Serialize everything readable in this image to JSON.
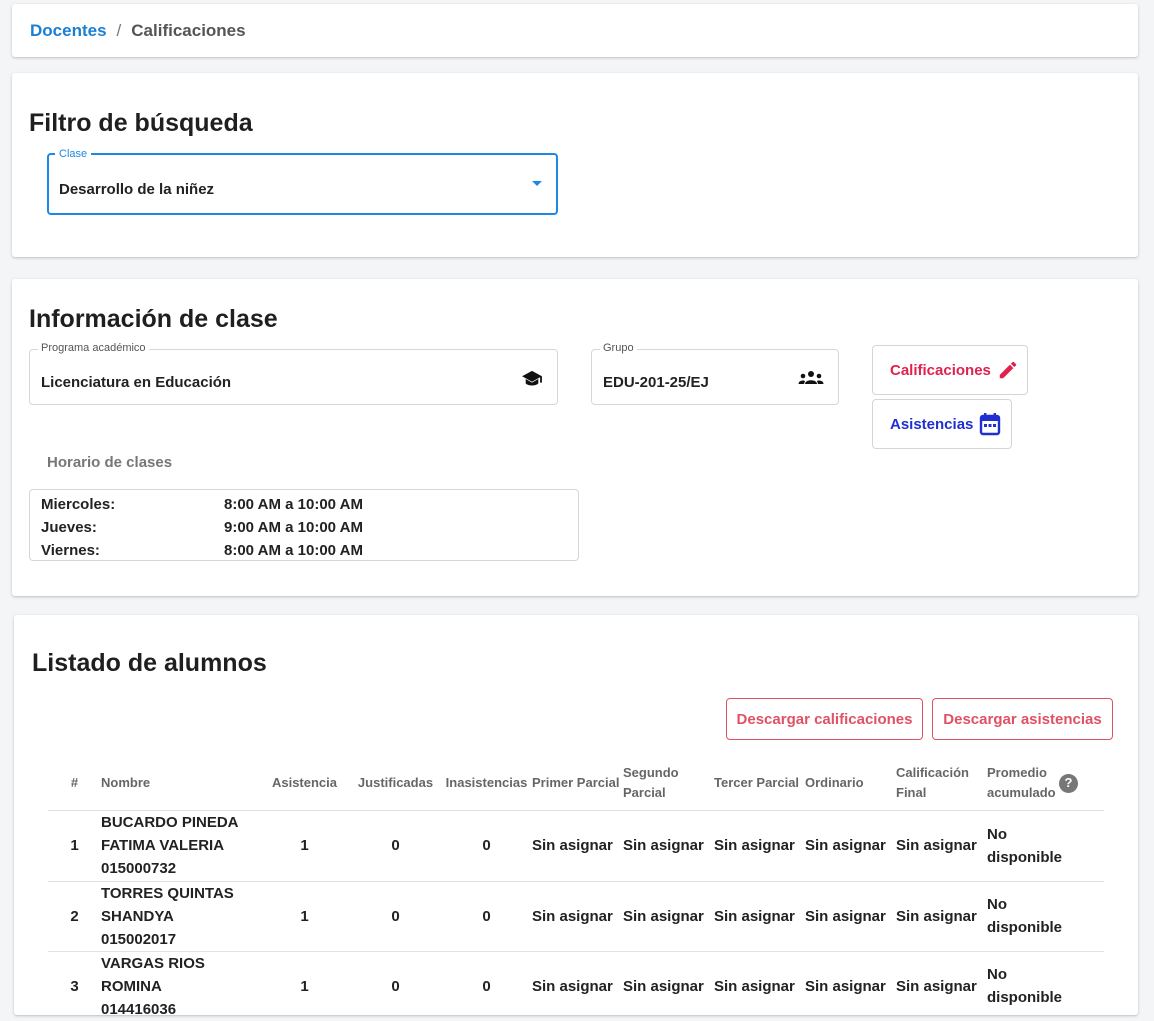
{
  "breadcrumb": {
    "parent": "Docentes",
    "separator": "/",
    "current": "Calificaciones"
  },
  "filter": {
    "title": "Filtro de búsqueda",
    "clase": {
      "label": "Clase",
      "value": "Desarrollo de la niñez"
    }
  },
  "class_info": {
    "title": "Información de clase",
    "programa": {
      "label": "Programa académico",
      "value": "Licenciatura en Educación"
    },
    "grupo": {
      "label": "Grupo",
      "value": "EDU-201-25/EJ"
    },
    "buttons": {
      "calificaciones": "Calificaciones",
      "asistencias": "Asistencias"
    },
    "schedule_label": "Horario de clases",
    "schedule": [
      {
        "day": "Miercoles:",
        "time": "8:00 AM a 10:00 AM"
      },
      {
        "day": "Jueves:",
        "time": "9:00 AM a 10:00 AM"
      },
      {
        "day": "Viernes:",
        "time": "8:00 AM a 10:00 AM"
      }
    ]
  },
  "students": {
    "title": "Listado de alumnos",
    "buttons": {
      "download_grades": "Descargar calificaciones",
      "download_attendance": "Descargar asistencias"
    },
    "headers": {
      "num": "#",
      "nombre": "Nombre",
      "asistencia": "Asistencia",
      "justificadas": "Justificadas",
      "inasistencias": "Inasistencias",
      "primer": "Primer Parcial",
      "segundo": "Segundo Parcial",
      "tercer": "Tercer Parcial",
      "ordinario": "Ordinario",
      "final": "Calificación Final",
      "promedio": "Promedio acumulado"
    },
    "rows": [
      {
        "num": "1",
        "name_lines": [
          "BUCARDO PINEDA",
          "FATIMA VALERIA",
          "015000732"
        ],
        "asistencia": "1",
        "justificadas": "0",
        "inasistencias": "0",
        "primer": "Sin asignar",
        "segundo": "Sin asignar",
        "tercer": "Sin asignar",
        "ordinario": "Sin asignar",
        "final": "Sin asignar",
        "promedio_lines": [
          "No",
          "disponible"
        ]
      },
      {
        "num": "2",
        "name_lines": [
          "TORRES QUINTAS",
          "SHANDYA",
          "015002017"
        ],
        "asistencia": "1",
        "justificadas": "0",
        "inasistencias": "0",
        "primer": "Sin asignar",
        "segundo": "Sin asignar",
        "tercer": "Sin asignar",
        "ordinario": "Sin asignar",
        "final": "Sin asignar",
        "promedio_lines": [
          "No",
          "disponible"
        ]
      },
      {
        "num": "3",
        "name_lines": [
          "VARGAS RIOS ROMINA",
          "014416036"
        ],
        "asistencia": "1",
        "justificadas": "0",
        "inasistencias": "0",
        "primer": "Sin asignar",
        "segundo": "Sin asignar",
        "tercer": "Sin asignar",
        "ordinario": "Sin asignar",
        "final": "Sin asignar",
        "promedio_lines": [
          "No",
          "disponible"
        ]
      }
    ]
  },
  "colors": {
    "primary": "#1e88e5",
    "link": "#1b7fd4",
    "accent_red": "#e0234e",
    "button_blue": "#1f2fd0",
    "outline_red": "#e05263"
  },
  "icons": {
    "programa": "graduation-cap-icon",
    "grupo": "group-icon",
    "calificaciones": "pencil-icon",
    "asistencias": "calendar-icon",
    "help": "help-circle-icon"
  }
}
